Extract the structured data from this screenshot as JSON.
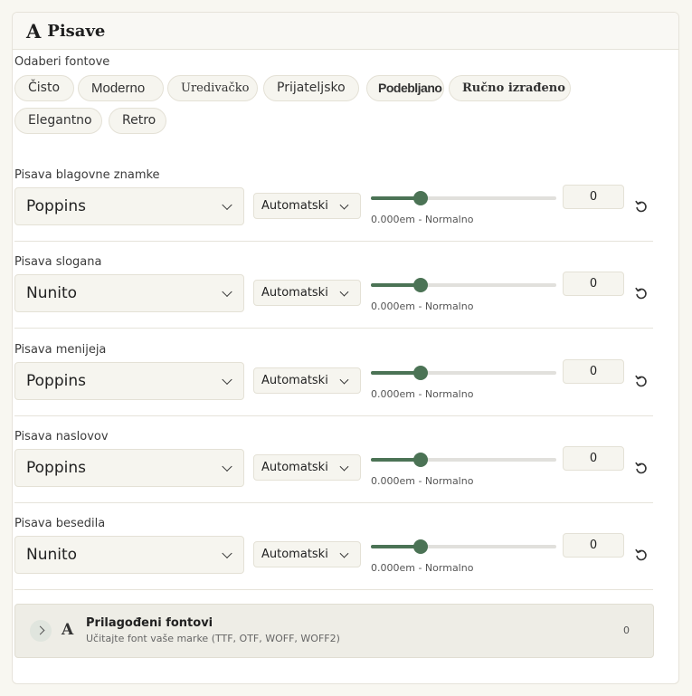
{
  "panel": {
    "title": "Pisave",
    "icon": "font-letter-icon"
  },
  "presets": {
    "label": "Odaberi fontove",
    "items": [
      "Čisto",
      "Moderno",
      "Uredivačko",
      "Prijateljsko",
      "Podebljano",
      "Ručno izrađeno",
      "Elegantno",
      "Retro"
    ]
  },
  "rows": [
    {
      "label": "Pisava blagovne znamke",
      "font": "Poppins",
      "weight": "Automatski",
      "spacing_caption": "0.000em - Normalno",
      "value": "0",
      "slider_fraction": 0.27
    },
    {
      "label": "Pisava slogana",
      "font": "Nunito",
      "weight": "Automatski",
      "spacing_caption": "0.000em - Normalno",
      "value": "0",
      "slider_fraction": 0.27
    },
    {
      "label": "Pisava menijeja",
      "font": "Poppins",
      "weight": "Automatski",
      "spacing_caption": "0.000em - Normalno",
      "value": "0",
      "slider_fraction": 0.27
    },
    {
      "label": "Pisava naslovov",
      "font": "Poppins",
      "weight": "Automatski",
      "spacing_caption": "0.000em - Normalno",
      "value": "0",
      "slider_fraction": 0.27
    },
    {
      "label": "Pisava besedila",
      "font": "Nunito",
      "weight": "Automatski",
      "spacing_caption": "0.000em - Normalno",
      "value": "0",
      "slider_fraction": 0.27
    }
  ],
  "custom_fonts": {
    "title": "Prilagođeni fontovi",
    "subtitle": "Učitajte font vaše marke (TTF, OTF, WOFF, WOFF2)",
    "count": "0"
  },
  "colors": {
    "accent": "#4b7355",
    "chip_bg": "#f6f5ef",
    "border": "#e4e1d6"
  }
}
